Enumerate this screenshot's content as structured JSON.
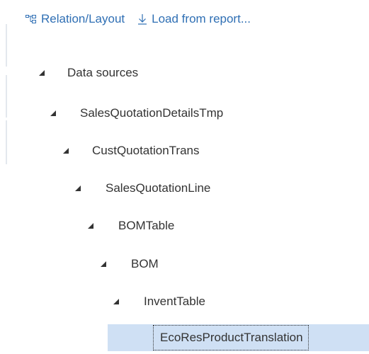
{
  "toolbar": {
    "relation_layout": {
      "label": "Relation/Layout",
      "icon": "relation-layout-icon"
    },
    "load_from_report": {
      "label": "Load from report...",
      "icon": "download-arrow-icon"
    }
  },
  "tree": {
    "nodes": [
      {
        "label": "Data sources",
        "expanded": true
      },
      {
        "label": "SalesQuotationDetailsTmp",
        "expanded": true
      },
      {
        "label": "CustQuotationTrans",
        "expanded": true
      },
      {
        "label": "SalesQuotationLine",
        "expanded": true
      },
      {
        "label": "BOMTable",
        "expanded": true
      },
      {
        "label": "BOM",
        "expanded": true
      },
      {
        "label": "InventTable",
        "expanded": true
      },
      {
        "label": "EcoResProductTranslation",
        "selected": true
      }
    ]
  },
  "colors": {
    "link": "#2f6fb4",
    "selection": "#cfe0f4",
    "text": "#333333"
  }
}
